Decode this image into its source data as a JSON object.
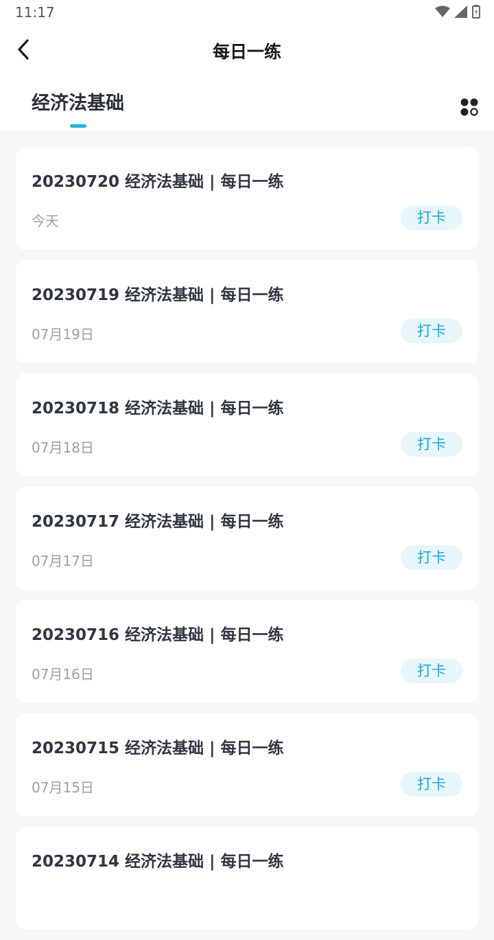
{
  "status_bar": {
    "time": "11:17"
  },
  "header": {
    "title": "每日一练"
  },
  "tabs": [
    {
      "label": "经济法基础"
    }
  ],
  "items": [
    {
      "title": "20230720 经济法基础 | 每日一练",
      "date": "今天",
      "action": "打卡"
    },
    {
      "title": "20230719 经济法基础 | 每日一练",
      "date": "07月19日",
      "action": "打卡"
    },
    {
      "title": "20230718 经济法基础 | 每日一练",
      "date": "07月18日",
      "action": "打卡"
    },
    {
      "title": "20230717 经济法基础 | 每日一练",
      "date": "07月17日",
      "action": "打卡"
    },
    {
      "title": "20230716 经济法基础 | 每日一练",
      "date": "07月16日",
      "action": "打卡"
    },
    {
      "title": "20230715 经济法基础 | 每日一练",
      "date": "07月15日",
      "action": "打卡"
    },
    {
      "title": "20230714 经济法基础 | 每日一练",
      "date": "",
      "action": ""
    }
  ],
  "colors": {
    "accent": "#22b0d6",
    "button_bg": "#e6f6fb",
    "page_bg": "#f5f7f9"
  }
}
